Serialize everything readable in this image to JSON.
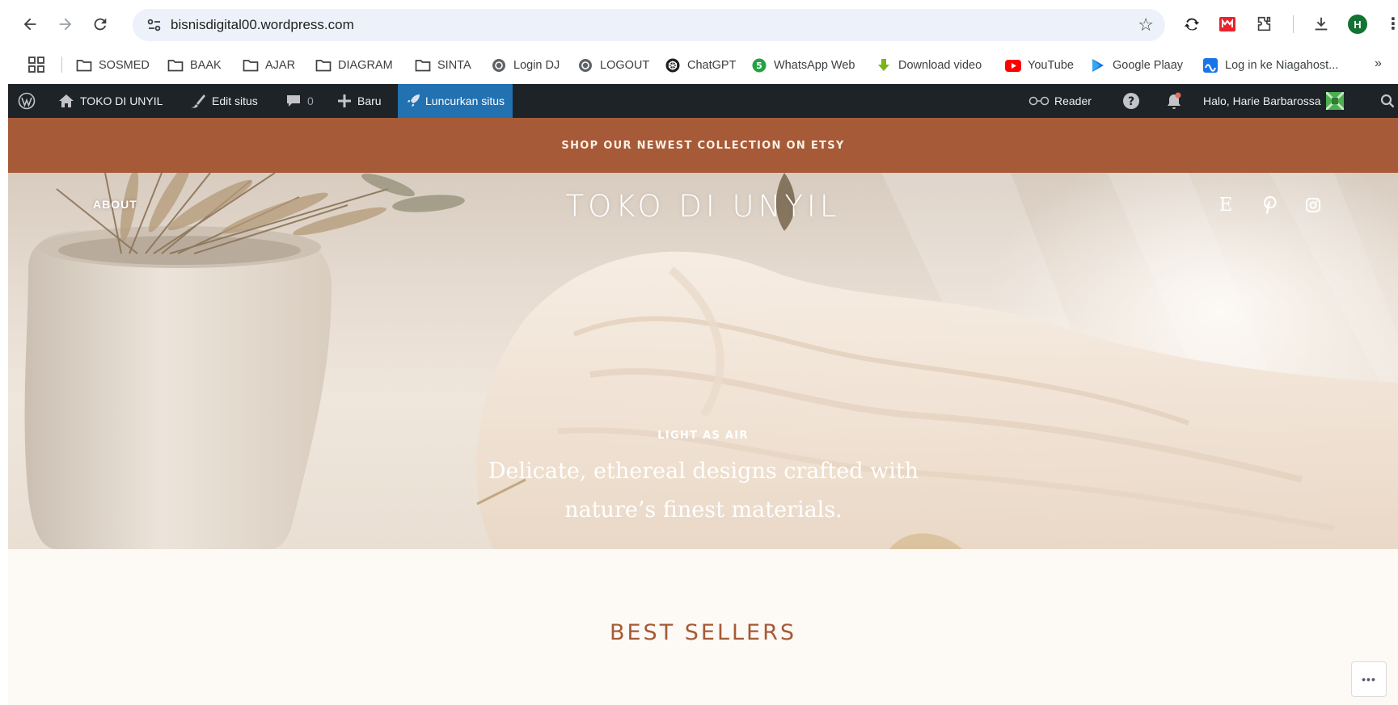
{
  "browser": {
    "url": "bisnisdigital00.wordpress.com",
    "profile_initial": "H",
    "bookmarks": [
      {
        "label": "SOSMED",
        "icon": "folder-icon"
      },
      {
        "label": "BAAK",
        "icon": "folder-icon"
      },
      {
        "label": "AJAR",
        "icon": "folder-icon"
      },
      {
        "label": "DIAGRAM",
        "icon": "folder-icon"
      },
      {
        "label": "SINTA",
        "icon": "folder-icon"
      },
      {
        "label": "Login DJ",
        "icon": "globe-icon"
      },
      {
        "label": "LOGOUT",
        "icon": "globe-icon"
      },
      {
        "label": "ChatGPT",
        "icon": "chatgpt-icon"
      },
      {
        "label": "WhatsApp Web",
        "icon": "whatsapp-icon"
      },
      {
        "label": "Download video",
        "icon": "download-video-icon"
      },
      {
        "label": "YouTube",
        "icon": "youtube-icon"
      },
      {
        "label": "Google Plaay",
        "icon": "google-play-icon"
      },
      {
        "label": "Log in ke Niagahost...",
        "icon": "niagahoster-icon"
      }
    ]
  },
  "admin_bar": {
    "site_name": "TOKO DI UNYIL",
    "edit_label": "Edit situs",
    "comments_count": "0",
    "new_label": "Baru",
    "launch_label": "Luncurkan situs",
    "reader_label": "Reader",
    "greeting": "Halo, Harie Barbarossa"
  },
  "site": {
    "promo_text": "SHOP OUR NEWEST COLLECTION ON ETSY",
    "nav_about": "ABOUT",
    "logo": "TOKO DI UNYIL",
    "social": [
      {
        "icon": "etsy-icon",
        "glyph": "E"
      },
      {
        "icon": "pinterest-icon"
      },
      {
        "icon": "instagram-icon"
      }
    ],
    "hero_kicker": "LIGHT AS AIR",
    "hero_tagline": "Delicate, ethereal designs crafted with nature’s finest materials.",
    "section_title": "BEST SELLERS"
  },
  "colors": {
    "promo_bg": "#a65a37",
    "admin_bar_bg": "#1d2327",
    "launch_bg": "#2271b1",
    "accent_text": "#a65a37",
    "page_bg": "#fdf9f5"
  }
}
